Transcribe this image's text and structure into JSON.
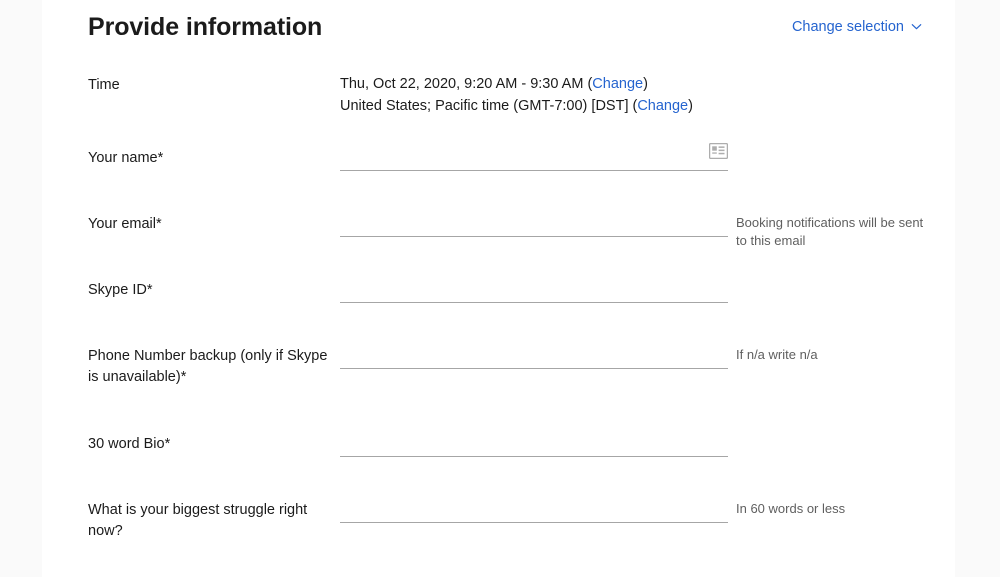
{
  "header": {
    "title": "Provide information",
    "change_selection_label": "Change selection",
    "chevron_icon": "chevron-down-icon"
  },
  "colors": {
    "link": "#2564cf",
    "text": "#1b1b1b",
    "hint": "#5f5f5f",
    "underline": "#a6a6a6",
    "page_background": "#fafafa",
    "card_background": "#ffffff"
  },
  "time_row": {
    "label": "Time",
    "datetime_text": "Thu, Oct 22, 2020, 9:20 AM - 9:30 AM (",
    "datetime_change_label": "Change",
    "datetime_close": ")",
    "timezone_text": "United States; Pacific time (GMT-7:00) [DST] (",
    "timezone_change_label": "Change",
    "timezone_close": ")"
  },
  "fields": [
    {
      "label": "Your name*",
      "value": "",
      "placeholder": "",
      "hint": "",
      "icon": "contact-card-icon"
    },
    {
      "label": "Your email*",
      "value": "",
      "placeholder": "",
      "hint": "Booking notifications will be sent to this email",
      "icon": ""
    },
    {
      "label": "Skype ID*",
      "value": "",
      "placeholder": "",
      "hint": "",
      "icon": ""
    },
    {
      "label": "Phone Number backup (only if Skype is unavailable)*",
      "value": "",
      "placeholder": "",
      "hint": "If n/a write n/a",
      "icon": ""
    },
    {
      "label": "30 word Bio*",
      "value": "",
      "placeholder": "",
      "hint": "",
      "icon": ""
    },
    {
      "label": "What is your biggest struggle right now?",
      "value": "",
      "placeholder": "",
      "hint": "In 60 words or less",
      "icon": ""
    }
  ]
}
